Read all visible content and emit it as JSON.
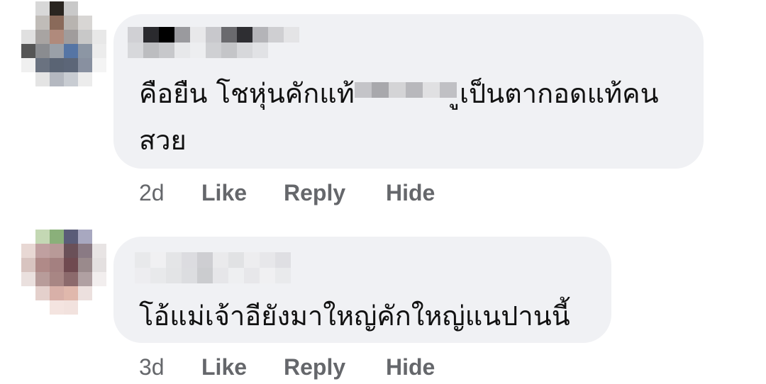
{
  "comments": [
    {
      "text_line1": "คือยืน โชหุ่นคักแท้",
      "text_line1_tail": "ูเป็นตากอดแท้คน",
      "text_line2": "สวย",
      "time": "2d",
      "like_label": "Like",
      "reply_label": "Reply",
      "hide_label": "Hide"
    },
    {
      "text_line1": "โอ้แม่เจ้าอียังมาใหญ่คักใหญ่แนปานนี้",
      "time": "3d",
      "like_label": "Like",
      "reply_label": "Reply",
      "hide_label": "Hide"
    }
  ]
}
